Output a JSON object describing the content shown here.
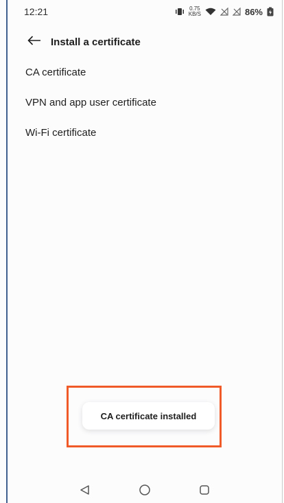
{
  "status_bar": {
    "time": "12:21",
    "net_speed_value": "0.75",
    "net_speed_unit": "KB/S",
    "battery_percent": "86%",
    "icons": [
      "vibrate-icon",
      "wifi-icon",
      "no-signal-icon",
      "no-signal-icon",
      "battery-icon"
    ]
  },
  "app_bar": {
    "back_icon": "arrow-left-icon",
    "title": "Install a certificate"
  },
  "list": {
    "items": [
      {
        "label": "CA certificate"
      },
      {
        "label": "VPN and app user certificate"
      },
      {
        "label": "Wi-Fi certificate"
      }
    ]
  },
  "toast": {
    "message": "CA certificate installed",
    "highlight_color": "#f05a28"
  },
  "nav_bar": {
    "icons": [
      "back-triangle-icon",
      "home-circle-icon",
      "recents-square-icon"
    ]
  }
}
